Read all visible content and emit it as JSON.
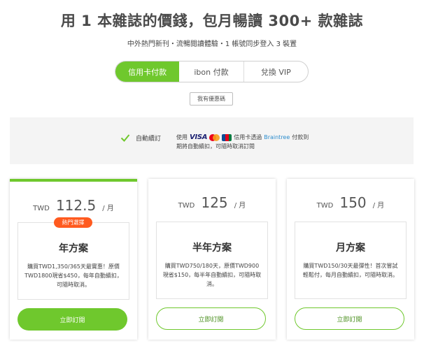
{
  "headline": "用 1 本雜誌的價錢，包月暢讀 300+ 款雜誌",
  "subline": "中外熱門新刊・流暢閱讀體驗・1 帳號同步登入 3 裝置",
  "payment_tabs": [
    {
      "label": "信用卡付款",
      "active": true
    },
    {
      "label": "ibon 付款",
      "active": false
    },
    {
      "label": "兌換 VIP",
      "active": false
    }
  ],
  "coupon_label": "我有優惠碼",
  "info": {
    "auto_renew": "自動續訂",
    "use_prefix": "使用",
    "visa": "VISA",
    "card_via": "信用卡透過",
    "braintree": "Braintree",
    "pay_suffix": "付款到",
    "line2": "期將自動續扣，可隨時取消訂閱"
  },
  "plans": [
    {
      "currency": "TWD",
      "amount": "112.5",
      "per": "/ 月",
      "badge": "熱門選擇",
      "name": "年方案",
      "desc": "購買TWD1,350/365天最實惠！原價TWD1800現省$450，每年自動續扣，可隨時取消。",
      "button": "立即訂閱"
    },
    {
      "currency": "TWD",
      "amount": "125",
      "per": "/ 月",
      "badge": "",
      "name": "半年方案",
      "desc": "購買TWD750/180天，原價TWD900現省$150，每半年自動續扣，可隨時取消。",
      "button": "立即訂閱"
    },
    {
      "currency": "TWD",
      "amount": "150",
      "per": "/ 月",
      "badge": "",
      "name": "月方案",
      "desc": "購買TWD150/30天最彈性！首次嘗試輕鬆付，每月自動續扣，可隨時取消。",
      "button": "立即訂閱"
    }
  ],
  "colors": {
    "accent": "#6fc82d",
    "badge": "#ff5a1f",
    "info_bg": "#f4f4f4"
  }
}
